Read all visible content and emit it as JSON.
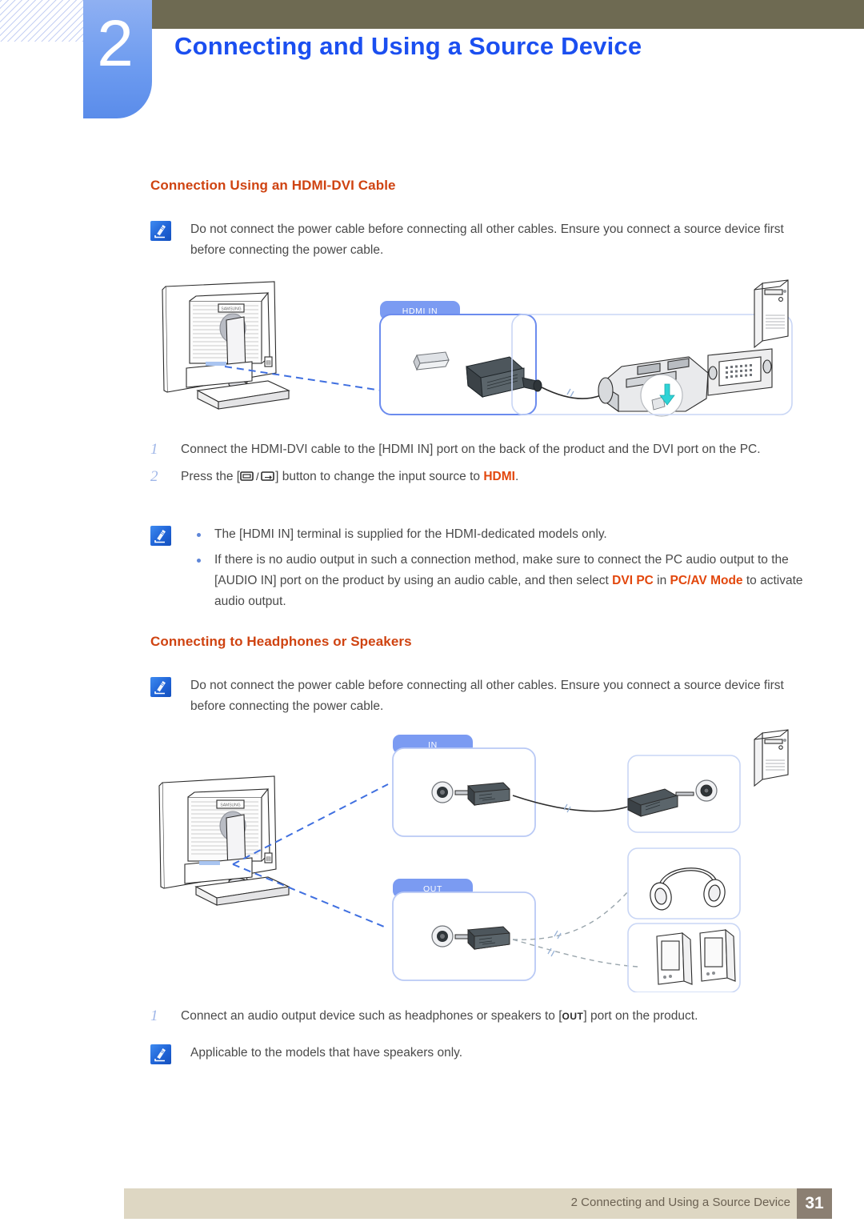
{
  "header": {
    "chapter_number": "2",
    "chapter_title": "Connecting and Using a Source Device",
    "bar_color": "#6e6a52",
    "badge_color": "#6e9cf0",
    "title_color": "#1b4ff0"
  },
  "section1": {
    "heading": "Connection Using an HDMI-DVI Cable",
    "heading_color": "#cf4311",
    "note": "Do not connect the power cable before connecting all other cables. Ensure you connect a source device first before connecting the power cable.",
    "diagram": {
      "callout_hdmi_in": "HDMI IN",
      "device_monitor_brand": "SAMSUNG"
    },
    "steps": [
      {
        "num": "1",
        "text_before": "Connect the HDMI-DVI cable to the [HDMI IN] port on the back of the product and the DVI port on the PC.",
        "text_after": ""
      },
      {
        "num": "2",
        "text_before": "Press the [",
        "key_glyph": "source-key",
        "text_mid": "] button to change the input source to ",
        "highlight": "HDMI",
        "text_after": "."
      }
    ],
    "bullets": [
      {
        "text": "The [HDMI IN] terminal is supplied for the HDMI-dedicated models only."
      },
      {
        "text_a": "If there is no audio output in such a connection method, make sure to connect the PC audio output to the [AUDIO IN] port on the product by using an audio cable, and then select ",
        "highlight_a": "DVI PC",
        "text_b": " in ",
        "highlight_b": "PC/AV Mode",
        "text_c": " to activate audio output."
      }
    ]
  },
  "section2": {
    "heading": "Connecting to Headphones or Speakers",
    "note": "Do not connect the power cable before connecting all other cables. Ensure you connect a source device first before connecting the power cable.",
    "diagram": {
      "callout_in": "IN",
      "callout_out": "OUT",
      "device_monitor_brand": "SAMSUNG"
    },
    "steps": [
      {
        "num": "1",
        "text_before": "Connect an audio output device such as headphones or speakers to [",
        "key_glyph": "OUT",
        "text_after": "] port on the product."
      }
    ],
    "note2": "Applicable to the models that have speakers only."
  },
  "footer": {
    "text": "2 Connecting and Using a Source Device",
    "page_number": "31",
    "bar_color": "#ded7c3",
    "page_box_color": "#8b7f72"
  }
}
